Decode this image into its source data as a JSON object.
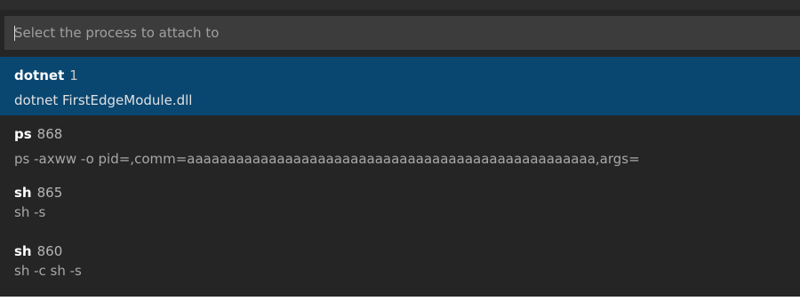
{
  "quickpick": {
    "placeholder": "Select the process to attach to",
    "items": [
      {
        "name": "dotnet",
        "pid": "1",
        "command": "dotnet FirstEdgeModule.dll",
        "selected": true
      },
      {
        "name": "ps",
        "pid": "868",
        "command": "ps -axww -o pid=,comm=aaaaaaaaaaaaaaaaaaaaaaaaaaaaaaaaaaaaaaaaaaaaaaaaaa,args=",
        "selected": false
      },
      {
        "name": "sh",
        "pid": "865",
        "command": "sh -s",
        "selected": false
      },
      {
        "name": "sh",
        "pid": "860",
        "command": "sh -c sh -s",
        "selected": false
      }
    ]
  },
  "colors": {
    "background": "#252526",
    "input_background": "#3c3c3c",
    "selection": "#094771"
  }
}
